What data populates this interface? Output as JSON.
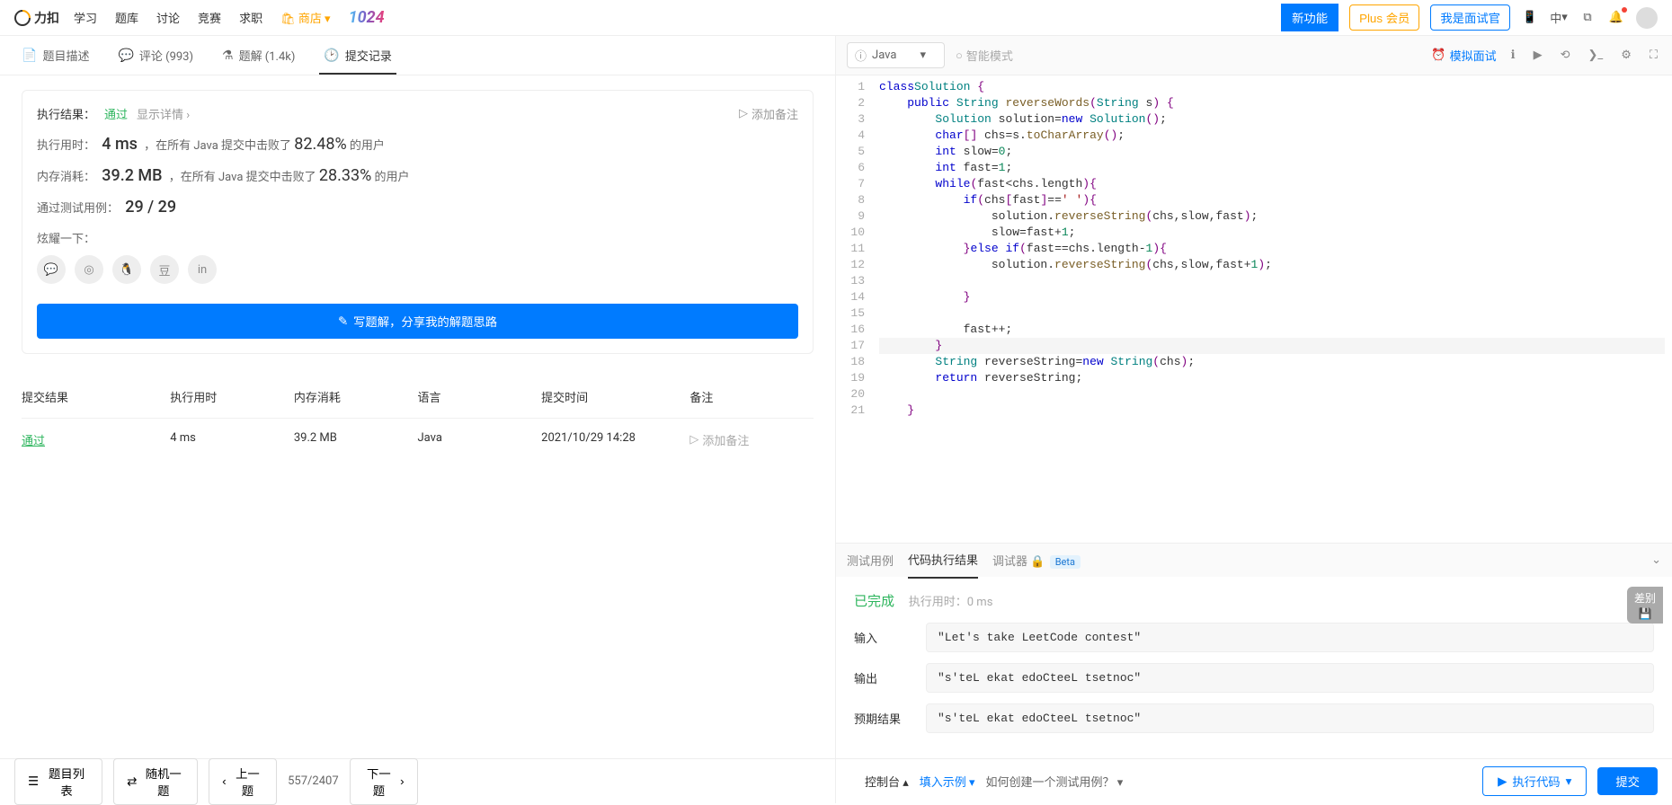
{
  "nav": {
    "logo": "力扣",
    "items": [
      "学习",
      "题库",
      "讨论",
      "竞赛",
      "求职"
    ],
    "shop": "商店",
    "logo2": "1024",
    "new_feature": "新功能",
    "plus": "Plus 会员",
    "interviewer": "我是面试官",
    "lang": "中"
  },
  "tabs": {
    "desc": "题目描述",
    "comments": "评论 (993)",
    "solutions": "题解 (1.4k)",
    "submissions": "提交记录"
  },
  "result": {
    "head_label": "执行结果：",
    "status": "通过",
    "show_detail": "显示详情",
    "add_note": "添加备注",
    "time_label": "执行用时：",
    "time_value": "4 ms",
    "time_text1": "，在所有 Java 提交中击败了",
    "time_pct": "82.48%",
    "time_text2": "的用户",
    "mem_label": "内存消耗：",
    "mem_value": "39.2 MB",
    "mem_text1": "，在所有 Java 提交中击败了",
    "mem_pct": "28.33%",
    "mem_text2": "的用户",
    "cases_label": "通过测试用例：",
    "cases_value": "29 / 29",
    "share_label": "炫耀一下：",
    "write_solution": "写题解，分享我的解题思路"
  },
  "history": {
    "headers": {
      "result": "提交结果",
      "time": "执行用时",
      "mem": "内存消耗",
      "lang": "语言",
      "submitted": "提交时间",
      "note": "备注"
    },
    "rows": [
      {
        "result": "通过",
        "time": "4 ms",
        "mem": "39.2 MB",
        "lang": "Java",
        "submitted": "2021/10/29 14:28",
        "note": "添加备注"
      }
    ]
  },
  "editor": {
    "language": "Java",
    "mode": "智能模式",
    "mock": "模拟面试",
    "code_lines": [
      [
        [
          "kw",
          "class"
        ],
        [
          "",
          ""
        ],
        [
          "cls",
          "Solution"
        ],
        [
          "",
          " "
        ],
        [
          "br",
          "{"
        ]
      ],
      [
        [
          "",
          "    "
        ],
        [
          "kw",
          "public"
        ],
        [
          "",
          " "
        ],
        [
          "cls",
          "String"
        ],
        [
          "",
          " "
        ],
        [
          "mth",
          "reverseWords"
        ],
        [
          "br",
          "("
        ],
        [
          "cls",
          "String"
        ],
        [
          "",
          " s"
        ],
        [
          "br",
          ")"
        ],
        [
          "",
          " "
        ],
        [
          "br",
          "{"
        ]
      ],
      [
        [
          "",
          "        "
        ],
        [
          "cls",
          "Solution"
        ],
        [
          "",
          " solution="
        ],
        [
          "kw",
          "new"
        ],
        [
          "",
          " "
        ],
        [
          "cls",
          "Solution"
        ],
        [
          "br",
          "()"
        ],
        [
          "",
          ";"
        ]
      ],
      [
        [
          "",
          "        "
        ],
        [
          "kw",
          "char"
        ],
        [
          "br",
          "[]"
        ],
        [
          "",
          " chs=s."
        ],
        [
          "mth",
          "toCharArray"
        ],
        [
          "br",
          "()"
        ],
        [
          "",
          ";"
        ]
      ],
      [
        [
          "",
          "        "
        ],
        [
          "kw",
          "int"
        ],
        [
          "",
          " slow="
        ],
        [
          "num",
          "0"
        ],
        [
          "",
          ";"
        ]
      ],
      [
        [
          "",
          "        "
        ],
        [
          "kw",
          "int"
        ],
        [
          "",
          " fast="
        ],
        [
          "num",
          "1"
        ],
        [
          "",
          ";"
        ]
      ],
      [
        [
          "",
          "        "
        ],
        [
          "kw",
          "while"
        ],
        [
          "br",
          "("
        ],
        [
          "",
          "fast<chs.length"
        ],
        [
          "br",
          ")"
        ],
        [
          "br",
          "{"
        ]
      ],
      [
        [
          "",
          "            "
        ],
        [
          "kw",
          "if"
        ],
        [
          "br",
          "("
        ],
        [
          "",
          "chs"
        ],
        [
          "br",
          "["
        ],
        [
          "",
          "fast"
        ],
        [
          "br",
          "]"
        ],
        [
          "",
          "=="
        ],
        [
          "str",
          "' '"
        ],
        [
          "br",
          ")"
        ],
        [
          "br",
          "{"
        ]
      ],
      [
        [
          "",
          "                solution."
        ],
        [
          "mth",
          "reverseString"
        ],
        [
          "br",
          "("
        ],
        [
          "",
          "chs,slow,fast"
        ],
        [
          "br",
          ")"
        ],
        [
          "",
          ";"
        ]
      ],
      [
        [
          "",
          "                slow=fast+"
        ],
        [
          "num",
          "1"
        ],
        [
          "",
          ";"
        ]
      ],
      [
        [
          "",
          "            "
        ],
        [
          "br",
          "}"
        ],
        [
          "kw",
          "else"
        ],
        [
          "",
          " "
        ],
        [
          "kw",
          "if"
        ],
        [
          "br",
          "("
        ],
        [
          "",
          "fast==chs.length-"
        ],
        [
          "num",
          "1"
        ],
        [
          "br",
          ")"
        ],
        [
          "br",
          "{"
        ]
      ],
      [
        [
          "",
          "                solution."
        ],
        [
          "mth",
          "reverseString"
        ],
        [
          "br",
          "("
        ],
        [
          "",
          "chs,slow,fast+"
        ],
        [
          "num",
          "1"
        ],
        [
          "br",
          ")"
        ],
        [
          "",
          ";"
        ]
      ],
      [
        [
          "",
          ""
        ]
      ],
      [
        [
          "",
          "            "
        ],
        [
          "br",
          "}"
        ]
      ],
      [
        [
          "",
          ""
        ]
      ],
      [
        [
          "",
          "            fast++;"
        ]
      ],
      [
        [
          "",
          "        "
        ],
        [
          "br",
          "}"
        ]
      ],
      [
        [
          "",
          "        "
        ],
        [
          "cls",
          "String"
        ],
        [
          "",
          " reverseString="
        ],
        [
          "kw",
          "new"
        ],
        [
          "",
          " "
        ],
        [
          "cls",
          "String"
        ],
        [
          "br",
          "("
        ],
        [
          "",
          "chs"
        ],
        [
          "br",
          ")"
        ],
        [
          "",
          ";"
        ]
      ],
      [
        [
          "",
          "        "
        ],
        [
          "kw",
          "return"
        ],
        [
          "",
          " reverseString;"
        ]
      ],
      [
        [
          "",
          ""
        ]
      ],
      [
        [
          "",
          "    "
        ],
        [
          "br",
          "}"
        ]
      ]
    ]
  },
  "console": {
    "tab_test": "测试用例",
    "tab_result": "代码执行结果",
    "tab_debug": "调试器",
    "beta": "Beta",
    "done": "已完成",
    "exec_time_label": "执行用时：",
    "exec_time_val": "0 ms",
    "input_label": "输入",
    "input_val": "\"Let's take LeetCode contest\"",
    "output_label": "输出",
    "output_val": "\"s'teL ekat edoCteeL tsetnoc\"",
    "expected_label": "预期结果",
    "expected_val": "\"s'teL ekat edoCteeL tsetnoc\"",
    "diff": "差别"
  },
  "bottom": {
    "list": "题目列表",
    "random": "随机一题",
    "prev": "上一题",
    "counter": "557/2407",
    "next": "下一题",
    "console": "控制台",
    "fill": "填入示例",
    "help": "如何创建一个测试用例？",
    "run": "执行代码",
    "submit": "提交"
  }
}
